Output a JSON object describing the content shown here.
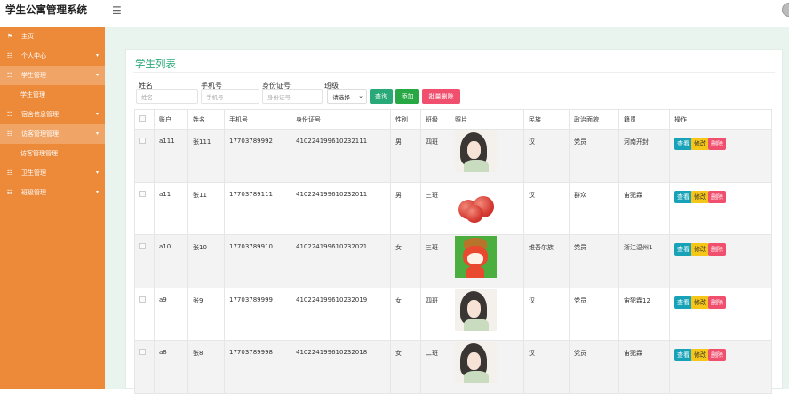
{
  "app": {
    "title": "学生公寓管理系统",
    "menu_icon": "hamburger-icon"
  },
  "sidebar": {
    "items": [
      {
        "label": "主页",
        "icon": "flag-icon",
        "expandable": false,
        "sub": []
      },
      {
        "label": "个人中心",
        "icon": "grid-icon",
        "expandable": true,
        "sub": []
      },
      {
        "label": "学生管理",
        "icon": "grid-icon",
        "expandable": true,
        "open": true,
        "sub": [
          "学生管理"
        ]
      },
      {
        "label": "宿舍信息管理",
        "icon": "grid-icon",
        "expandable": true,
        "sub": []
      },
      {
        "label": "访客管理管理",
        "icon": "grid-icon",
        "expandable": true,
        "open": true,
        "sub": [
          "访客管理管理"
        ]
      },
      {
        "label": "卫生管理",
        "icon": "grid-icon",
        "expandable": true,
        "sub": []
      },
      {
        "label": "班级管理",
        "icon": "grid-icon",
        "expandable": true,
        "sub": []
      }
    ]
  },
  "panel": {
    "title": "学生列表"
  },
  "filters": {
    "name_label": "姓名",
    "name_placeholder": "姓名",
    "phone_label": "手机号",
    "phone_placeholder": "手机号",
    "id_label": "身份证号",
    "id_placeholder": "身份证号",
    "class_label": "班级",
    "class_selected": "-请选择-"
  },
  "buttons": {
    "search": "查询",
    "add": "添加",
    "batch_delete": "批量删除"
  },
  "colors": {
    "sidebar": "#ec8a3a",
    "accent": "#2aa978",
    "search": "#2aa978",
    "add": "#28a745",
    "delete": "#f0506e",
    "view": "#17a2b8",
    "edit": "#f5c518"
  },
  "table": {
    "headers": [
      "账户",
      "姓名",
      "手机号",
      "身份证号",
      "性别",
      "班级",
      "照片",
      "民族",
      "政治面貌",
      "籍贯",
      "操作"
    ],
    "rows": [
      {
        "account": "a111",
        "name": "张111",
        "phone": "17703789992",
        "id_card": "410224199610232111",
        "gender": "男",
        "class": "四班",
        "photo": "girl-portrait",
        "ethnicity": "汉",
        "political": "党员",
        "origin": "河南开封"
      },
      {
        "account": "a11",
        "name": "张11",
        "phone": "17703789111",
        "id_card": "410224199610232011",
        "gender": "男",
        "class": "三班",
        "photo": "apples",
        "ethnicity": "汉",
        "political": "群众",
        "origin": "宙犯霖"
      },
      {
        "account": "a10",
        "name": "张10",
        "phone": "17703789910",
        "id_card": "410224199610232021",
        "gender": "女",
        "class": "三班",
        "photo": "cartoon-fox",
        "ethnicity": "维吾尔族",
        "political": "党员",
        "origin": "浙江温州1"
      },
      {
        "account": "a9",
        "name": "张9",
        "phone": "17703789999",
        "id_card": "410224199610232019",
        "gender": "女",
        "class": "四班",
        "photo": "girl-portrait",
        "ethnicity": "汉",
        "political": "党员",
        "origin": "宙犯霖12"
      },
      {
        "account": "a8",
        "name": "张8",
        "phone": "17703789998",
        "id_card": "410224199610232018",
        "gender": "女",
        "class": "二班",
        "photo": "girl-portrait",
        "ethnicity": "汉",
        "political": "党员",
        "origin": "宙犯霖"
      }
    ],
    "actions": {
      "view": "查看",
      "edit": "修改",
      "delete": "删除"
    }
  }
}
